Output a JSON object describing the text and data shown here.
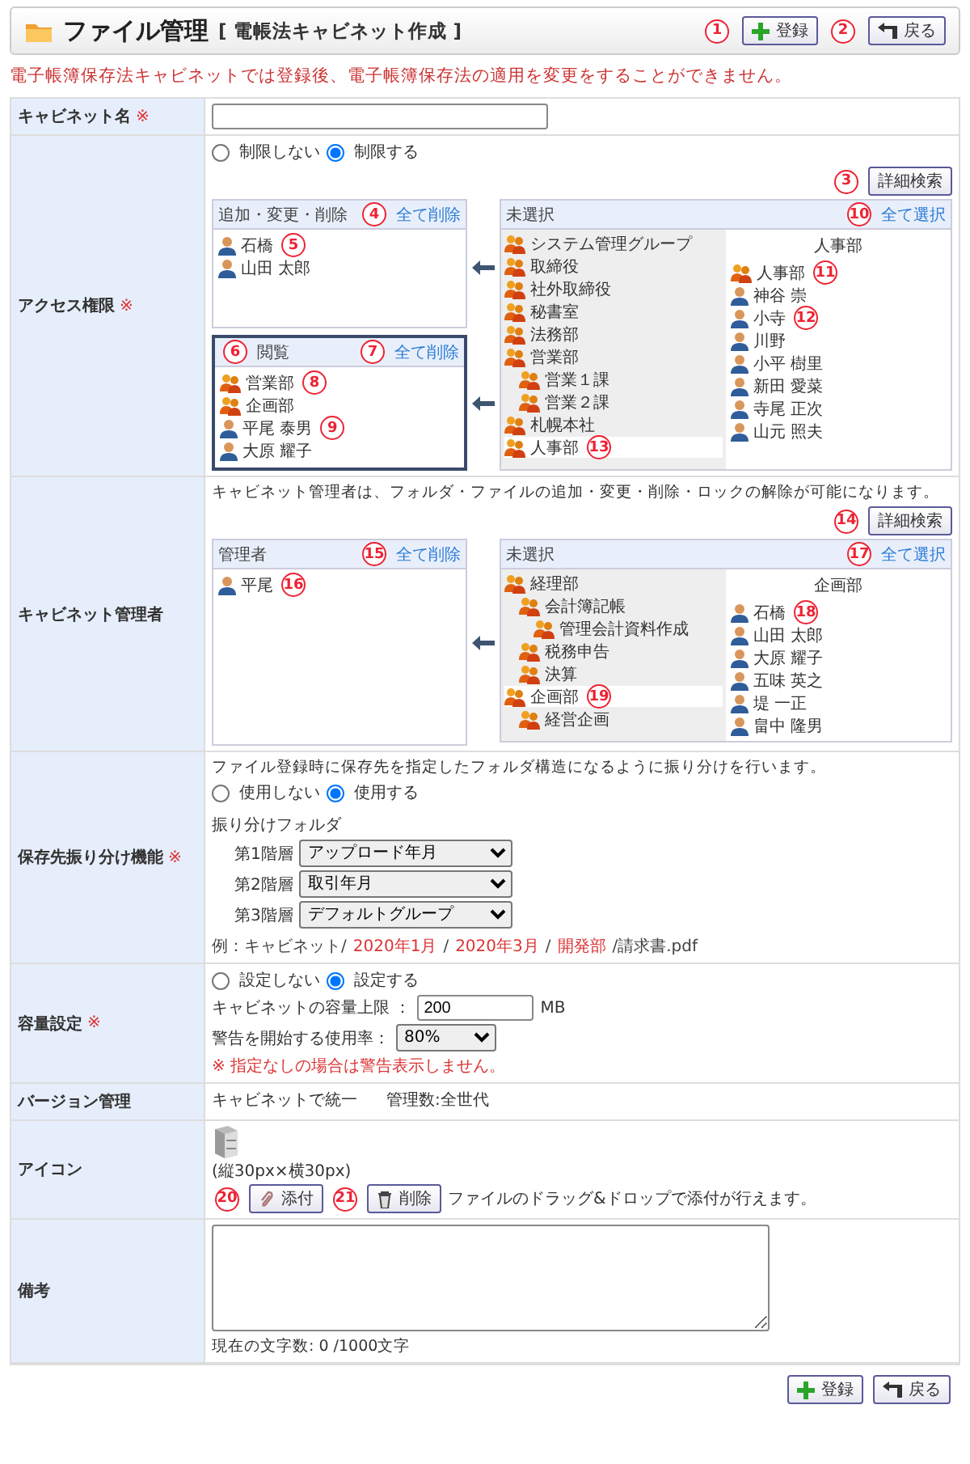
{
  "header": {
    "title": "ファイル管理",
    "subtitle": "[ 電帳法キャビネット作成 ]",
    "buttons": [
      {
        "kind": "register",
        "label": "登録",
        "callout": "1"
      },
      {
        "kind": "back",
        "label": "戻る",
        "callout": "2"
      }
    ]
  },
  "notice": "電子帳簿保存法キャビネットでは登録後、電子帳簿保存法の適用を変更をすることができません。",
  "name_row": {
    "label": "キャビネット名",
    "required_mark": "※"
  },
  "access": {
    "label": "アクセス権限",
    "required_mark": "※",
    "options": [
      {
        "label": "制限しない",
        "selected": false
      },
      {
        "label": "制限する",
        "selected": true
      }
    ],
    "search_button": {
      "label": "詳細検索",
      "callout": "3"
    },
    "panels": [
      {
        "title": "追加・変更・削除",
        "selected": false,
        "clear": {
          "label": "全て削除",
          "callout": "4"
        },
        "items": [
          {
            "kind": "user",
            "name": "石橋",
            "callout": "5"
          },
          {
            "kind": "user",
            "name": "山田 太郎"
          }
        ]
      },
      {
        "title": "閲覧",
        "title_callout": "6",
        "selected": true,
        "clear": {
          "label": "全て削除",
          "callout": "7"
        },
        "items": [
          {
            "kind": "group",
            "name": "営業部",
            "callout": "8"
          },
          {
            "kind": "group",
            "name": "企画部"
          },
          {
            "kind": "user",
            "name": "平尾 泰男",
            "callout": "9"
          },
          {
            "kind": "user",
            "name": "大原 耀子"
          }
        ]
      }
    ],
    "unselected": {
      "title": "未選択",
      "select_all": {
        "label": "全て選択",
        "callout": "10"
      },
      "tree": [
        {
          "name": "システム管理グループ",
          "selected": false
        },
        {
          "name": "取締役",
          "selected": false
        },
        {
          "name": "社外取締役",
          "selected": false
        },
        {
          "name": "秘書室",
          "selected": false
        },
        {
          "name": "法務部",
          "selected": false
        },
        {
          "name": "営業部",
          "selected": false,
          "children": [
            {
              "name": "営業１課",
              "selected": false
            },
            {
              "name": "営業２課",
              "selected": false
            }
          ]
        },
        {
          "name": "札幌本社",
          "selected": false
        },
        {
          "name": "人事部",
          "selected": true,
          "callout": "13"
        }
      ],
      "list_heading": "人事部",
      "items": [
        {
          "kind": "group",
          "name": "人事部",
          "callout": "11"
        },
        {
          "kind": "user",
          "name": "神谷 崇"
        },
        {
          "kind": "user",
          "name": "小寺",
          "callout": "12"
        },
        {
          "kind": "user",
          "name": "川野"
        },
        {
          "kind": "user",
          "name": "小平 樹里"
        },
        {
          "kind": "user",
          "name": "新田 愛菜"
        },
        {
          "kind": "user",
          "name": "寺尾 正次"
        },
        {
          "kind": "user",
          "name": "山元 照夫"
        }
      ]
    }
  },
  "admin": {
    "label": "キャビネット管理者",
    "description": "キャビネット管理者は、フォルダ・ファイルの追加・変更・削除・ロックの解除が可能になります。",
    "search_button": {
      "label": "詳細検索",
      "callout": "14"
    },
    "panel": {
      "title": "管理者",
      "selected": false,
      "clear": {
        "label": "全て削除",
        "callout": "15"
      },
      "items": [
        {
          "kind": "user",
          "name": "平尾",
          "callout": "16"
        }
      ]
    },
    "unselected": {
      "title": "未選択",
      "select_all": {
        "label": "全て選択",
        "callout": "17"
      },
      "tree": [
        {
          "name": "経理部",
          "selected": false,
          "children": [
            {
              "name": "会計簿記帳",
              "selected": false,
              "children": [
                {
                  "name": "管理会計資料作成",
                  "selected": false
                }
              ]
            },
            {
              "name": "税務申告",
              "selected": false
            },
            {
              "name": "決算",
              "selected": false
            }
          ]
        },
        {
          "name": "企画部",
          "selected": true,
          "callout": "19",
          "children": [
            {
              "name": "経営企画",
              "selected": false
            }
          ]
        }
      ],
      "list_heading": "企画部",
      "items": [
        {
          "kind": "user",
          "name": "石橋",
          "callout": "18"
        },
        {
          "kind": "user",
          "name": "山田 太郎"
        },
        {
          "kind": "user",
          "name": "大原 耀子"
        },
        {
          "kind": "user",
          "name": "五味 英之"
        },
        {
          "kind": "user",
          "name": "堤 一正"
        },
        {
          "kind": "user",
          "name": "畠中 隆男"
        }
      ]
    }
  },
  "sorting": {
    "label": "保存先振り分け機能",
    "required_mark": "※",
    "description": "ファイル登録時に保存先を指定したフォルダ構造になるように振り分けを行います。",
    "options": [
      {
        "label": "使用しない",
        "selected": false
      },
      {
        "label": "使用する",
        "selected": true
      }
    ],
    "folder_label": "振り分けフォルダ",
    "levels": [
      {
        "label": "第1階層",
        "value": "アップロード年月"
      },
      {
        "label": "第2階層",
        "value": "取引年月"
      },
      {
        "label": "第3階層",
        "value": "デフォルトグループ"
      }
    ],
    "example": [
      {
        "text": "例：キャビネット/",
        "highlight": false
      },
      {
        "text": "2020年1月",
        "highlight": true
      },
      {
        "text": "/",
        "highlight": false
      },
      {
        "text": "2020年3月",
        "highlight": true
      },
      {
        "text": "/",
        "highlight": false
      },
      {
        "text": "開発部",
        "highlight": true
      },
      {
        "text": "/請求書.pdf",
        "highlight": false
      }
    ]
  },
  "capacity": {
    "label": "容量設定",
    "required_mark": "※",
    "options": [
      {
        "label": "設定しない",
        "selected": false
      },
      {
        "label": "設定する",
        "selected": true
      }
    ],
    "limit_label": "キャビネットの容量上限 ：",
    "limit_value": "200",
    "limit_unit": "MB",
    "warn_label": "警告を開始する使用率：",
    "warn_value": "80%",
    "note": "※ 指定なしの場合は警告表示しません。"
  },
  "version": {
    "label": "バージョン管理",
    "mode": "キャビネットで統一",
    "count": "管理数:全世代"
  },
  "icon": {
    "label": "アイコン",
    "size_note": "(縦30px×横30px)",
    "buttons": [
      {
        "kind": "attach",
        "label": "添付",
        "callout": "20"
      },
      {
        "kind": "delete",
        "label": "削除",
        "callout": "21"
      }
    ],
    "hint": "ファイルのドラッグ&ドロップで添付が行えます。"
  },
  "remarks": {
    "label": "備考",
    "counter": "現在の文字数: 0 /1000文字"
  },
  "footer": {
    "buttons": [
      {
        "kind": "register",
        "label": "登録"
      },
      {
        "kind": "back",
        "label": "戻る"
      }
    ]
  }
}
